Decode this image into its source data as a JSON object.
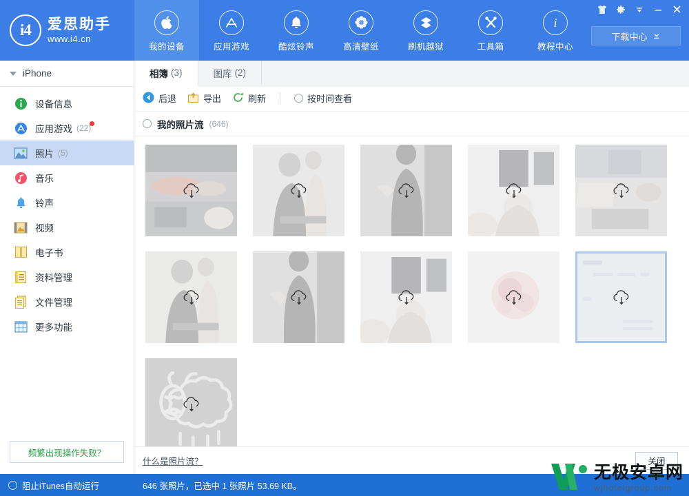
{
  "brand": {
    "logo_text": "i4",
    "name": "爱思助手",
    "url": "www.i4.cn"
  },
  "topnav": {
    "items": [
      {
        "label": "我的设备",
        "icon": "apple-icon",
        "active": true
      },
      {
        "label": "应用游戏",
        "icon": "appstore-icon",
        "active": false
      },
      {
        "label": "酷炫铃声",
        "icon": "bell-icon",
        "active": false
      },
      {
        "label": "高清壁纸",
        "icon": "flower-icon",
        "active": false
      },
      {
        "label": "刷机越狱",
        "icon": "dropbox-icon",
        "active": false
      },
      {
        "label": "工具箱",
        "icon": "tools-icon",
        "active": false
      },
      {
        "label": "教程中心",
        "icon": "info-icon",
        "active": false
      }
    ],
    "download_center": "下载中心"
  },
  "window_controls": {
    "shirt": "shirt-icon",
    "settings": "gear-icon",
    "dropdown": "chevron-down-icon",
    "minimize": "minimize-icon",
    "close": "close-icon"
  },
  "sidebar": {
    "device": "iPhone",
    "items": [
      {
        "label": "设备信息",
        "count": "",
        "icon": "info-circle-icon",
        "active": false,
        "badge": false
      },
      {
        "label": "应用游戏",
        "count": "(22)",
        "icon": "appstore-circle-icon",
        "active": false,
        "badge": true
      },
      {
        "label": "照片",
        "count": "(5)",
        "icon": "photo-icon",
        "active": true,
        "badge": false
      },
      {
        "label": "音乐",
        "count": "",
        "icon": "music-icon",
        "active": false,
        "badge": false
      },
      {
        "label": "铃声",
        "count": "",
        "icon": "ringtone-bell-icon",
        "active": false,
        "badge": false
      },
      {
        "label": "视频",
        "count": "",
        "icon": "video-film-icon",
        "active": false,
        "badge": false
      },
      {
        "label": "电子书",
        "count": "",
        "icon": "book-icon",
        "active": false,
        "badge": false
      },
      {
        "label": "资料管理",
        "count": "",
        "icon": "data-manage-icon",
        "active": false,
        "badge": false
      },
      {
        "label": "文件管理",
        "count": "",
        "icon": "file-manage-icon",
        "active": false,
        "badge": false
      },
      {
        "label": "更多功能",
        "count": "",
        "icon": "more-grid-icon",
        "active": false,
        "badge": false
      }
    ],
    "help_box": "频繁出现操作失败？"
  },
  "tabs": [
    {
      "label": "相簿",
      "count": "(3)",
      "active": true
    },
    {
      "label": "图库",
      "count": "(2)",
      "active": false
    }
  ],
  "toolbar": {
    "back": "后退",
    "export": "导出",
    "refresh": "刷新",
    "view_by_time": "按时间查看"
  },
  "album": {
    "name": "我的照片流",
    "count": "(646)"
  },
  "photos": [
    {
      "id": 1,
      "scene": "dinner-table",
      "selected": false
    },
    {
      "id": 2,
      "scene": "couple-child",
      "selected": false
    },
    {
      "id": 3,
      "scene": "woman-dress",
      "selected": false
    },
    {
      "id": 4,
      "scene": "window-portrait",
      "selected": false
    },
    {
      "id": 5,
      "scene": "desk-laptop",
      "selected": false
    },
    {
      "id": 6,
      "scene": "couple-child",
      "selected": false
    },
    {
      "id": 7,
      "scene": "woman-dress",
      "selected": false
    },
    {
      "id": 8,
      "scene": "window-portrait",
      "selected": false
    },
    {
      "id": 9,
      "scene": "pink-blossom",
      "selected": false
    },
    {
      "id": 10,
      "scene": "document-page",
      "selected": true
    },
    {
      "id": 11,
      "scene": "sheep-drawing",
      "selected": false
    }
  ],
  "footer": {
    "link": "什么是照片流？",
    "close": "关闭"
  },
  "statusbar": {
    "itunes_block": "阻止iTunes自动运行",
    "info": "646 张照片，已选中 1 张照片 53.69 KB。"
  },
  "watermark": {
    "main": "无极安卓网",
    "sub": "wjhotelgroup.com"
  },
  "colors": {
    "brand_blue": "#3c7ee6",
    "status_blue": "#1f6fd4",
    "sidebar_selected": "#c7d9f5",
    "selection_border": "#a8c8f0",
    "help_green": "#2aa24a",
    "badge_red": "#ea3d2f"
  }
}
